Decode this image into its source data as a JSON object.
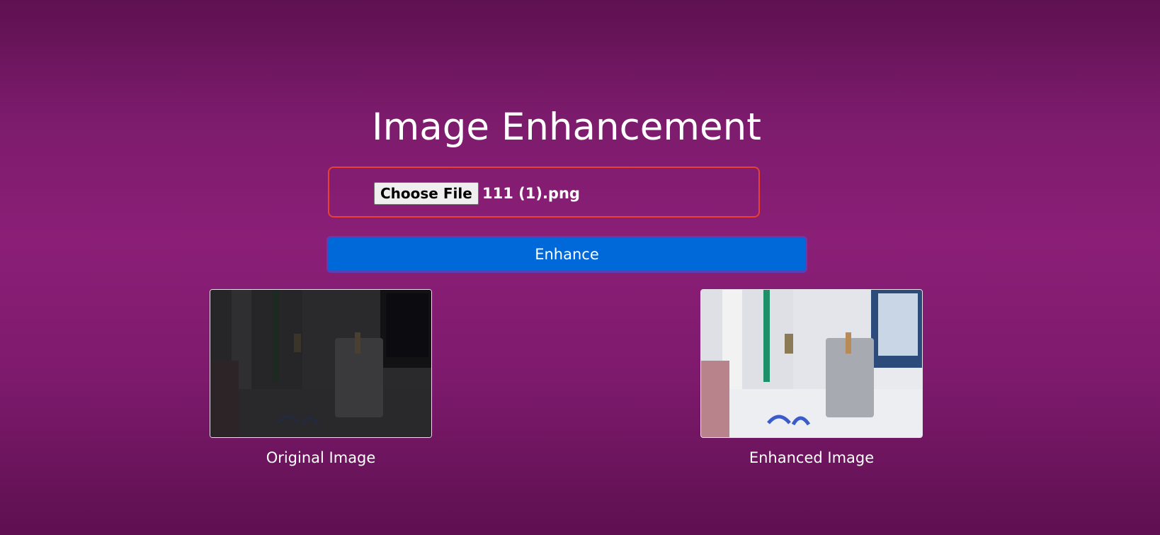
{
  "page": {
    "title": "Image Enhancement"
  },
  "upload": {
    "button_label": "Choose File",
    "file_name": "111 (1).png"
  },
  "actions": {
    "enhance_label": "Enhance"
  },
  "images": {
    "original_caption": "Original Image",
    "enhanced_caption": "Enhanced Image"
  },
  "colors": {
    "background": "#8b1f77",
    "upload_border": "#e8412f",
    "enhance_button": "#0069d9",
    "enhance_border": "#5b3fb5"
  }
}
